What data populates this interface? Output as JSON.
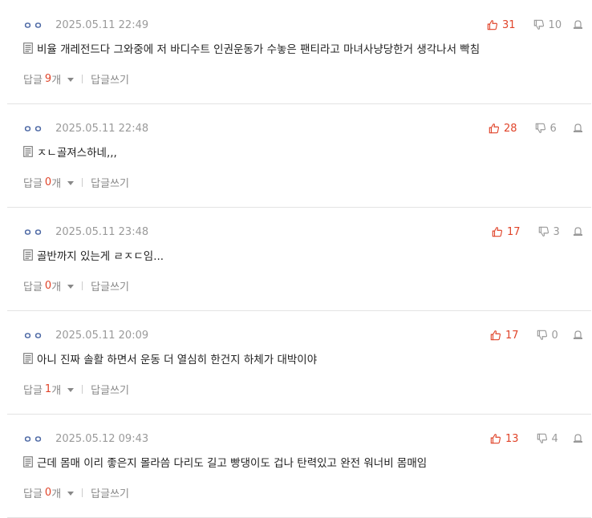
{
  "comments": [
    {
      "author": "ㅇㅇ",
      "date": "2025.05.11 22:49",
      "up": "31",
      "down": "10",
      "text": "비율 개레전드다 그와중에 저 바디수트 인권운동가 수놓은 팬티라고 마녀사냥당한거 생각나서 빡침",
      "reply_label": "답글",
      "reply_count": "9",
      "reply_unit": "개",
      "write_label": "답글쓰기"
    },
    {
      "author": "ㅇㅇ",
      "date": "2025.05.11 22:48",
      "up": "28",
      "down": "6",
      "text": "ㅈㄴ골져스하네,,,",
      "reply_label": "답글",
      "reply_count": "0",
      "reply_unit": "개",
      "write_label": "답글쓰기"
    },
    {
      "author": "ㅇㅇ",
      "date": "2025.05.11 23:48",
      "up": "17",
      "down": "3",
      "text": "골반까지 있는게 ㄹㅈㄷ임...",
      "reply_label": "답글",
      "reply_count": "0",
      "reply_unit": "개",
      "write_label": "답글쓰기"
    },
    {
      "author": "ㅇㅇ",
      "date": "2025.05.11 20:09",
      "up": "17",
      "down": "0",
      "text": "아니 진짜 솔활 하면서 운동 더 열심히 한건지 하체가 대박이야",
      "reply_label": "답글",
      "reply_count": "1",
      "reply_unit": "개",
      "write_label": "답글쓰기"
    },
    {
      "author": "ㅇㅇ",
      "date": "2025.05.12 09:43",
      "up": "13",
      "down": "4",
      "text": "근데 몸매 이리 좋은지 몰라씀 다리도 길고 빵댕이도 겁나 탄력있고 완전 워너비 몸매임",
      "reply_label": "답글",
      "reply_count": "0",
      "reply_unit": "개",
      "write_label": "답글쓰기"
    }
  ],
  "colors": {
    "accent": "#e0442a",
    "muted": "#999999",
    "author": "#4a66a3",
    "divider": "#e3e3e3"
  },
  "icons": {
    "up": "thumbs-up-icon",
    "down": "thumbs-down-icon",
    "report": "report-icon",
    "memo": "memo-icon",
    "caret": "caret-down-icon"
  }
}
